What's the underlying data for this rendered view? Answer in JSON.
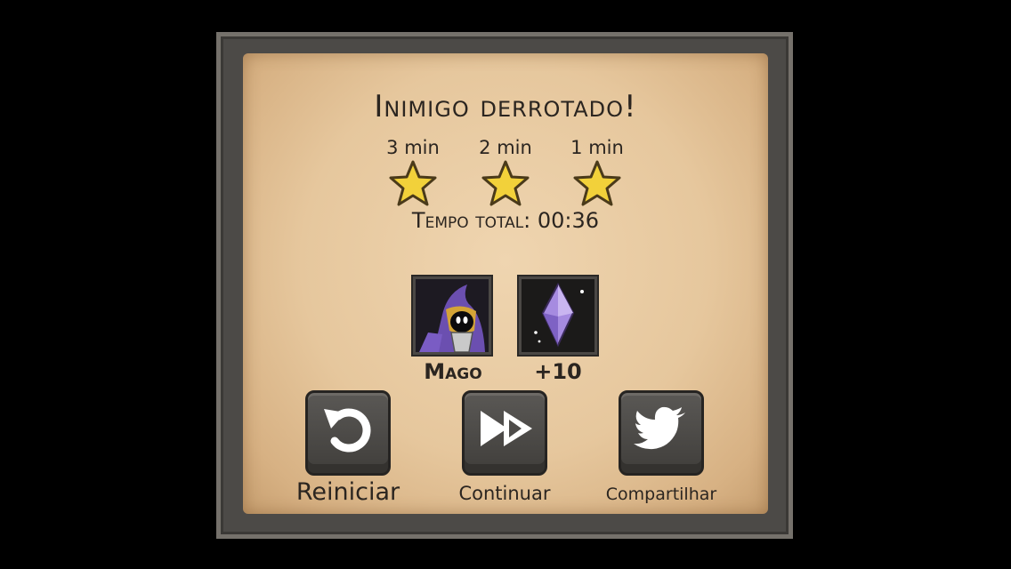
{
  "dialog": {
    "title": "Inimigo derrotado!",
    "stars": [
      {
        "label": "3 min",
        "earned": true
      },
      {
        "label": "2 min",
        "earned": true
      },
      {
        "label": "1 min",
        "earned": true
      }
    ],
    "total_time": "Tempo total: 00:36",
    "rewards": [
      {
        "label": "Mago",
        "icon": "wizard-portrait-icon"
      },
      {
        "label": "+10",
        "icon": "purple-crystal-icon"
      }
    ],
    "buttons": [
      {
        "label": "Reiniciar",
        "icon": "restart-icon"
      },
      {
        "label": "Continuar",
        "icon": "fast-forward-icon"
      },
      {
        "label": "Compartilhar",
        "icon": "twitter-bird-icon"
      }
    ]
  },
  "colors": {
    "background": "#000000",
    "parchment": "#e6c79d",
    "frame": "#4c4a47",
    "text": "#2b2520",
    "star_fill": "#f2d13a",
    "crystal": "#a68be0"
  }
}
